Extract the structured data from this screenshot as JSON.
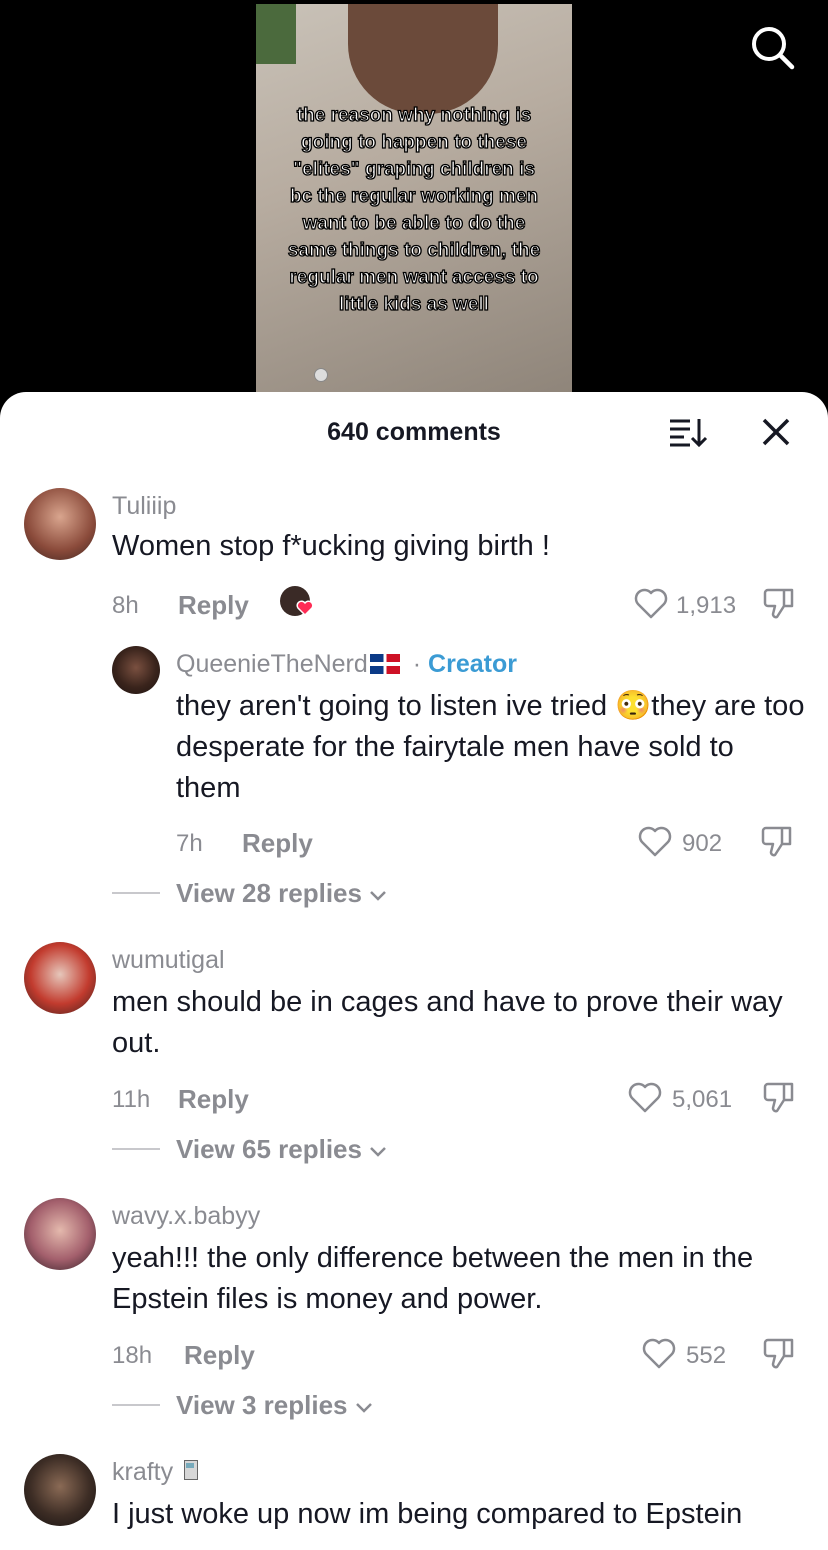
{
  "video": {
    "overlay_text": "the reason why nothing is going to happen to these \"elites\" graping children is bc the regular working men want to be able to do the same things to children, the regular men want access to little kids as well"
  },
  "header": {
    "title": "640 comments"
  },
  "comments": [
    {
      "username": "Tuliiip",
      "text": "Women stop f*ucking giving birth !",
      "time": "8h",
      "reply_label": "Reply",
      "likes": "1,913",
      "creator_liked": true,
      "reply": {
        "username": "QueenieTheNerd",
        "flag_icon": "dominican-republic-flag-icon",
        "separator": "·",
        "creator_label": "Creator",
        "text": "they aren't going to listen ive tried 😳they are too desperate for the fairytale men have sold to them",
        "time": "7h",
        "reply_label": "Reply",
        "likes": "902"
      },
      "view_replies": "View 28 replies"
    },
    {
      "username": "wumutigal",
      "text": "men should be in cages and have to prove their way out.",
      "time": "11h",
      "reply_label": "Reply",
      "likes": "5,061",
      "view_replies": "View 65 replies"
    },
    {
      "username": "wavy.x.babyy",
      "text": "yeah!!! the only difference between the men in the Epstein files is money and power.",
      "time": "18h",
      "reply_label": "Reply",
      "likes": "552",
      "view_replies": "View 3 replies"
    },
    {
      "username": "krafty",
      "badge_icon": "fuel-pump-emoji-icon",
      "text": "I just woke up now im being compared to Epstein"
    }
  ],
  "colors": {
    "text": "#161823",
    "muted": "#8a8b91",
    "creator": "#3b9bd4",
    "like_red": "#fe2c55"
  }
}
